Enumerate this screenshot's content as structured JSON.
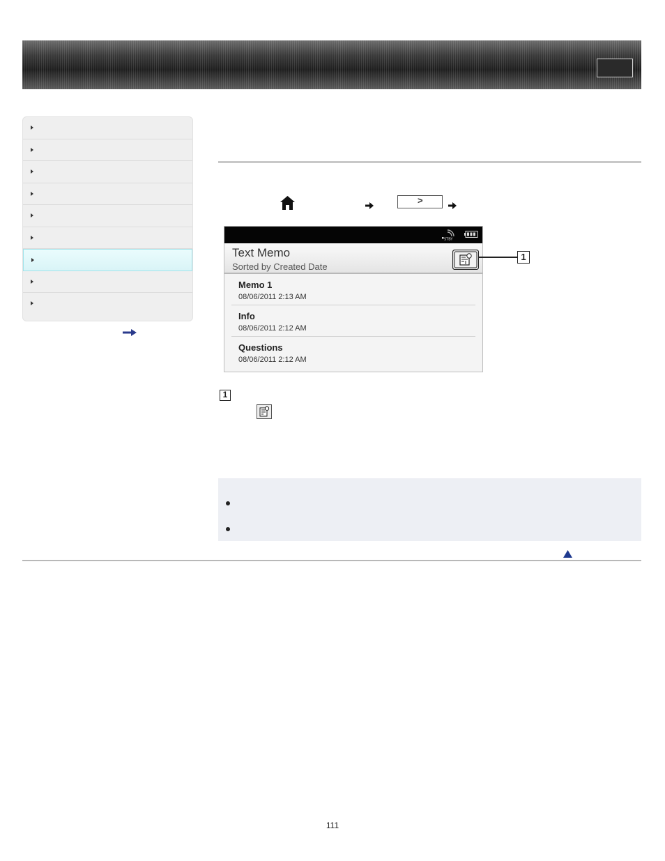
{
  "header": {
    "right_button_label": ""
  },
  "sidebar": {
    "items": [
      "",
      "",
      "",
      "",
      "",
      "",
      "",
      "",
      ""
    ],
    "active_index": 6
  },
  "device": {
    "title": "Text Memo",
    "subtitle": "Sorted by Created Date",
    "status_icons": [
      "stby-icon",
      "battery-icon"
    ],
    "memos": [
      {
        "name": "Memo 1",
        "date": "08/06/2011 2:13 AM"
      },
      {
        "name": "Info",
        "date": "08/06/2011 2:12 AM"
      },
      {
        "name": "Questions",
        "date": "08/06/2011 2:12 AM"
      }
    ]
  },
  "nav_path": {
    "next_symbol": ">"
  },
  "callouts": {
    "one": "1"
  },
  "note": {
    "bullets": [
      "",
      ""
    ]
  },
  "footer": {
    "page_number": "111"
  },
  "colors": {
    "active_item": "#dff7f9",
    "note_bg": "#edeff4",
    "arrow": "#2a3a8c"
  }
}
